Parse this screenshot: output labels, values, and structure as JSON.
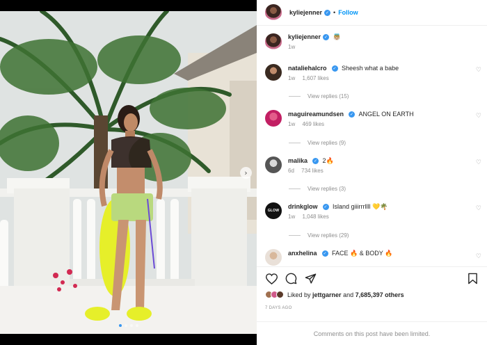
{
  "post": {
    "author": "kyliejenner",
    "follow_label": "Follow",
    "separator": "•",
    "caption_emoji": "👼🏼",
    "caption_time": "1w",
    "media_dots": 4
  },
  "comments": [
    {
      "username": "nataliehalcro",
      "text": "Sheesh what a babe",
      "time": "1w",
      "likes": "1,607 likes",
      "replies": "View replies (15)"
    },
    {
      "username": "maguireamundsen",
      "text": "ANGEL ON EARTH",
      "time": "1w",
      "likes": "469 likes",
      "replies": "View replies (9)"
    },
    {
      "username": "malika",
      "text": "2🔥",
      "time": "6d",
      "likes": "734 likes",
      "replies": "View replies (3)"
    },
    {
      "username": "drinkglow",
      "text": "Island giiirrrllll 💛🌴",
      "time": "1w",
      "likes": "1,048 likes",
      "replies": "View replies (29)"
    },
    {
      "username": "anxhelina",
      "text": "FACE 🔥 & BODY 🔥"
    }
  ],
  "likes": {
    "prefix": "Liked by",
    "user": "jettgarner",
    "and": "and",
    "count": "7,685,397 others"
  },
  "posted": "7 DAYS AGO",
  "limited_notice": "Comments on this post have been limited.",
  "icons": {
    "like": "heart-icon",
    "comment": "comment-icon",
    "share": "send-icon",
    "save": "bookmark-icon",
    "verified": "verified-badge-icon",
    "next": "chevron-right-icon"
  },
  "avatar_labels": {
    "drinkglow": "GLOW"
  },
  "colors": {
    "accent": "#0095f6",
    "verified": "#3897f0",
    "muted": "#8e8e8e"
  }
}
